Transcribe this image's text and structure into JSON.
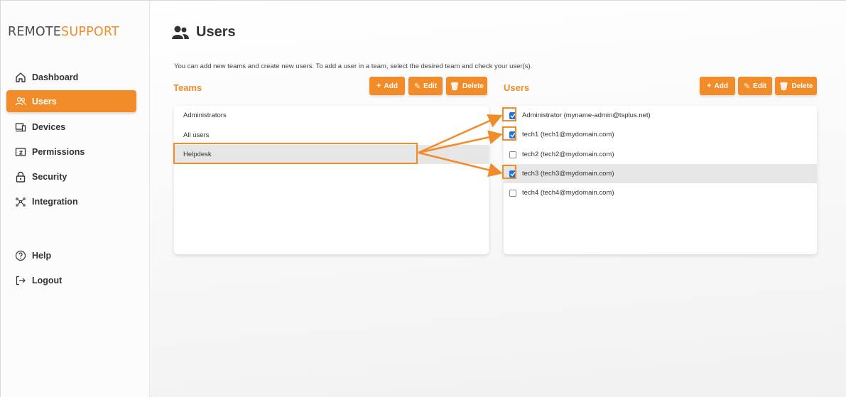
{
  "brand": {
    "part1": "REMOTE",
    "part2": "SUPPORT",
    "accent": "#f28c28"
  },
  "sidebar": {
    "items": [
      {
        "label": "Dashboard",
        "icon": "home-icon"
      },
      {
        "label": "Users",
        "icon": "users-icon",
        "active": true
      },
      {
        "label": "Devices",
        "icon": "devices-icon"
      },
      {
        "label": "Permissions",
        "icon": "permissions-icon"
      },
      {
        "label": "Security",
        "icon": "lock-icon"
      },
      {
        "label": "Integration",
        "icon": "integration-icon"
      },
      {
        "label": "Help",
        "icon": "help-icon"
      },
      {
        "label": "Logout",
        "icon": "logout-icon"
      }
    ]
  },
  "page": {
    "title": "Users",
    "intro": "You can add new teams and create new users. To add a user in a team, select the desired team and check your user(s)."
  },
  "teams": {
    "title": "Teams",
    "add": "Add",
    "edit": "Edit",
    "delete": "Delete",
    "items": [
      "Administrators",
      "All users",
      "Helpdesk"
    ],
    "selected": "Helpdesk"
  },
  "users": {
    "title": "Users",
    "add": "Add",
    "edit": "Edit",
    "delete": "Delete",
    "items": [
      {
        "label": "Administrator (myname-admin@tsplus.net)",
        "checked": true
      },
      {
        "label": "tech1 (tech1@mydomain.com)",
        "checked": true
      },
      {
        "label": "tech2 (tech2@mydomain.com)",
        "checked": false
      },
      {
        "label": "tech3 (tech3@mydomain.com)",
        "checked": true
      },
      {
        "label": "tech4 (tech4@mydomain.com)",
        "checked": false
      }
    ]
  }
}
